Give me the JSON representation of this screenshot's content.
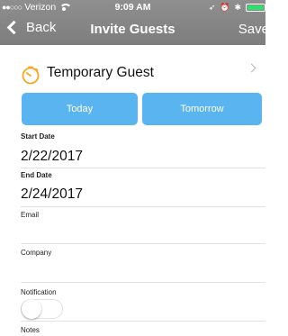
{
  "status_bar": {
    "carrier": "Verizon",
    "time": "9:09 AM",
    "battery_color": "#2ee06b"
  },
  "nav": {
    "back_label": "Back",
    "title": "Invite Guests",
    "save_label": "Save"
  },
  "guest_type": {
    "label": "Temporary Guest",
    "icon": "timer-icon",
    "accent": "#f5a623"
  },
  "date_buttons": {
    "today": "Today",
    "tomorrow": "Tomorrow",
    "color": "#5ab4ef"
  },
  "form": {
    "start_date_label": "Start Date",
    "start_date_value": "2/22/2017",
    "end_date_label": "End Date",
    "end_date_value": "2/24/2017",
    "email_label": "Email",
    "company_label": "Company",
    "notification_label": "Notification",
    "notification_on": false,
    "notes_label": "Notes"
  }
}
